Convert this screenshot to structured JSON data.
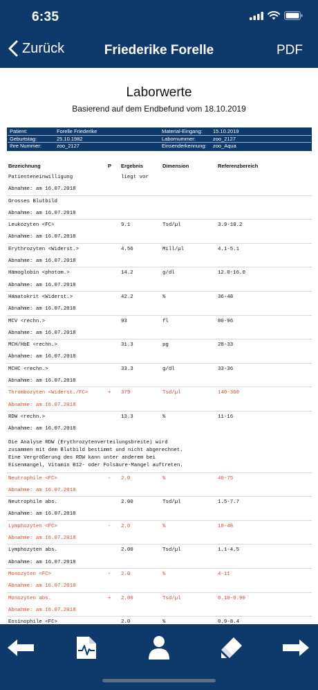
{
  "status_bar": {
    "time": "6:35"
  },
  "nav": {
    "back_label": "Zurück",
    "title": "Friederike Forelle",
    "pdf_label": "PDF"
  },
  "document": {
    "title": "Laborwerte",
    "subtitle": "Basierend auf dem Endbefund vom 18.10.2019",
    "info": [
      {
        "label1": "Patient:",
        "value1": "Forelle Friederike",
        "label2": "Material-Eingang:",
        "value2": "15.10.2019"
      },
      {
        "label1": "Geburtstag:",
        "value1": "25.10.1982",
        "label2": "Labornummer:",
        "value2": "zoo_2127"
      },
      {
        "label1": "Ihre Nummer:",
        "value1": "zoo_2127",
        "label2": "Einsenderkennung:",
        "value2": "zoo_Aqua"
      }
    ],
    "columns": {
      "name": "Bezeichnung",
      "p": "P",
      "result": "Ergebnis",
      "dimension": "Dimension",
      "reference": "Referenzbereich"
    },
    "rows": [
      {
        "kind": "value",
        "name": "Patienteneinwilligung",
        "p": "",
        "result": "liegt vor",
        "dim": "",
        "ref": "",
        "abnormal": false
      },
      {
        "kind": "date",
        "text": "Abnahme: am 16.07.2018",
        "abnormal": false
      },
      {
        "kind": "value",
        "name": "Grosses Blutbild",
        "p": "",
        "result": "",
        "dim": "",
        "ref": "",
        "abnormal": false
      },
      {
        "kind": "date",
        "text": "Abnahme: am 16.07.2018",
        "abnormal": false
      },
      {
        "kind": "value",
        "name": "Leukozyten <FC>",
        "p": "",
        "result": "9.1",
        "dim": "Tsd/µl",
        "ref": "3.9-10.2",
        "abnormal": false
      },
      {
        "kind": "date",
        "text": "Abnahme: am 16.07.2018",
        "abnormal": false
      },
      {
        "kind": "value",
        "name": "Erythrozyten <Widerst.>",
        "p": "",
        "result": "4.56",
        "dim": "Mill/µl",
        "ref": "4.1-5.1",
        "abnormal": false
      },
      {
        "kind": "date",
        "text": "Abnahme: am 16.07.2018",
        "abnormal": false
      },
      {
        "kind": "value",
        "name": "Hämoglobin <photom.>",
        "p": "",
        "result": "14.2",
        "dim": "g/dl",
        "ref": "12.0-16.0",
        "abnormal": false
      },
      {
        "kind": "date",
        "text": "Abnahme: am 16.07.2018",
        "abnormal": false
      },
      {
        "kind": "value",
        "name": "Hämatokrit <Widerst.>",
        "p": "",
        "result": "42.2",
        "dim": "%",
        "ref": "36-48",
        "abnormal": false
      },
      {
        "kind": "date",
        "text": "Abnahme: am 16.07.2018",
        "abnormal": false
      },
      {
        "kind": "value",
        "name": "MCV <rechn.>",
        "p": "",
        "result": "93",
        "dim": "fl",
        "ref": "80-96",
        "abnormal": false
      },
      {
        "kind": "date",
        "text": "Abnahme: am 16.07.2018",
        "abnormal": false
      },
      {
        "kind": "value",
        "name": "MCH/HbE <rechn.>",
        "p": "",
        "result": "31.3",
        "dim": "pg",
        "ref": "28-33",
        "abnormal": false
      },
      {
        "kind": "date",
        "text": "Abnahme: am 16.07.2018",
        "abnormal": false
      },
      {
        "kind": "value",
        "name": "MCHC <rechn.>",
        "p": "",
        "result": "33.3",
        "dim": "g/dl",
        "ref": "33-36",
        "abnormal": false
      },
      {
        "kind": "date",
        "text": "Abnahme: am 16.07.2018",
        "abnormal": false
      },
      {
        "kind": "value",
        "name": "Thrombozyten <Widerst./FC>",
        "p": "+",
        "result": "379",
        "dim": "Tsd/µl",
        "ref": "140-360",
        "abnormal": true
      },
      {
        "kind": "date",
        "text": "Abnahme: am 16.07.2018",
        "abnormal": true
      },
      {
        "kind": "value",
        "name": "RDW <rechn.>",
        "p": "",
        "result": "13.3",
        "dim": "%",
        "ref": "11-16",
        "abnormal": false
      },
      {
        "kind": "date-plain",
        "text": "Abnahme: am 16.07.2018",
        "abnormal": false
      },
      {
        "kind": "note",
        "text": "Die Analyse RDW (Erythrozytenverteilungsbreite) wird\nzusammen mit dem Blutbild bestimmt und nicht abgerechnet.\nEine Vergrößerung des RDW kann unter anderem bei\nEisenmangel, Vitamin B12- oder Folsäure-Mangel auftreten."
      },
      {
        "kind": "value",
        "name": "Neutrophile <FC>",
        "p": "-",
        "result": "2.0",
        "dim": "%",
        "ref": "40-75",
        "abnormal": true
      },
      {
        "kind": "date",
        "text": "Abnahme: am 16.07.2018",
        "abnormal": true
      },
      {
        "kind": "value",
        "name": "Neutrophile abs.",
        "p": "",
        "result": "2.00",
        "dim": "Tsd/µl",
        "ref": "1.5-7.7",
        "abnormal": false
      },
      {
        "kind": "date",
        "text": "Abnahme: am 16.07.2018",
        "abnormal": false
      },
      {
        "kind": "value",
        "name": "Lymphozyten <FC>",
        "p": "-",
        "result": "2.0",
        "dim": "%",
        "ref": "18-48",
        "abnormal": true
      },
      {
        "kind": "date",
        "text": "Abnahme: am 16.07.2018",
        "abnormal": true
      },
      {
        "kind": "value",
        "name": "Lymphozyten abs.",
        "p": "",
        "result": "2.00",
        "dim": "Tsd/µl",
        "ref": "1.1-4.5",
        "abnormal": false
      },
      {
        "kind": "date",
        "text": "Abnahme: am 16.07.2018",
        "abnormal": false
      },
      {
        "kind": "value",
        "name": "Monozyten <FC>",
        "p": "-",
        "result": "2.0",
        "dim": "%",
        "ref": "4-11",
        "abnormal": true
      },
      {
        "kind": "date",
        "text": "Abnahme: am 16.07.2018",
        "abnormal": true
      },
      {
        "kind": "value",
        "name": "Monozyten abs.",
        "p": "+",
        "result": "2.00",
        "dim": "Tsd/µl",
        "ref": "0.10-0.90",
        "abnormal": true
      },
      {
        "kind": "date",
        "text": "Abnahme: am 16.07.2018",
        "abnormal": true
      },
      {
        "kind": "value",
        "name": "Eosinophile <FC>",
        "p": "",
        "result": "2.0",
        "dim": "%",
        "ref": "0.9-8.4",
        "abnormal": false
      }
    ]
  },
  "toolbar": {
    "buttons": [
      {
        "name": "back-arrow-button",
        "icon": "arrow-left-icon"
      },
      {
        "name": "findings-document-button",
        "icon": "document-pulse-icon"
      },
      {
        "name": "patient-profile-button",
        "icon": "person-icon"
      },
      {
        "name": "highlighter-button",
        "icon": "highlighter-icon"
      },
      {
        "name": "forward-arrow-button",
        "icon": "arrow-right-icon"
      }
    ]
  },
  "colors": {
    "navy": "#0d3a6b",
    "abnormal": "#e2482b",
    "separator": "#d9d9d9"
  }
}
